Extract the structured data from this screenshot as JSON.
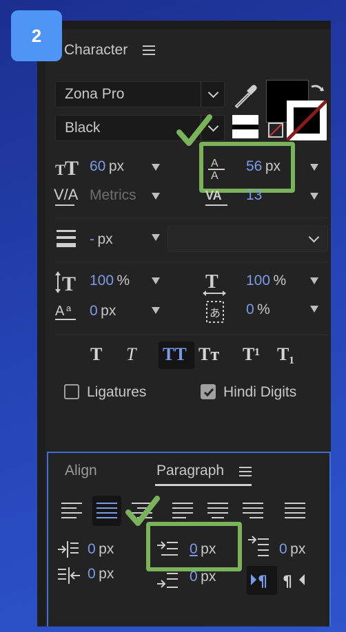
{
  "step_badge": "2",
  "character_panel": {
    "title": "Character",
    "font_family": "Zona Pro",
    "font_style": "Black",
    "font_size": {
      "value": "60",
      "unit": "px"
    },
    "leading": {
      "value": "56",
      "unit": "px"
    },
    "kerning": {
      "value": "Metrics"
    },
    "tracking": {
      "value": "13"
    },
    "stroke_width": {
      "value": "-",
      "unit": "px"
    },
    "vertical_scale": {
      "value": "100",
      "unit": "%"
    },
    "horizontal_scale": {
      "value": "100",
      "unit": "%"
    },
    "baseline_shift": {
      "value": "0",
      "unit": "px"
    },
    "tsume": {
      "value": "0",
      "unit": "%"
    },
    "style_buttons": [
      "T",
      "T",
      "TT",
      "Tт",
      "T¹",
      "T₁"
    ],
    "ligatures": {
      "label": "Ligatures",
      "checked": false
    },
    "hindi_digits": {
      "label": "Hindi Digits",
      "checked": true
    },
    "fill_color": "#000000",
    "stroke_color": "#ffffff"
  },
  "paragraph_panel": {
    "tabs": [
      "Align",
      "Paragraph"
    ],
    "active_tab": "Paragraph",
    "indent_left": {
      "value": "0",
      "unit": "px"
    },
    "space_before": {
      "value": "0",
      "unit": "px"
    },
    "indent_first_line": {
      "value": "0",
      "unit": "px"
    },
    "indent_right": {
      "value": "0",
      "unit": "px"
    },
    "space_after": {
      "value": "0",
      "unit": "px"
    }
  },
  "colors": {
    "accent_blue": "#7b9be8",
    "highlight_green": "#7bb35a",
    "panel_bg": "#232323",
    "badge_blue": "#4f95f5"
  }
}
